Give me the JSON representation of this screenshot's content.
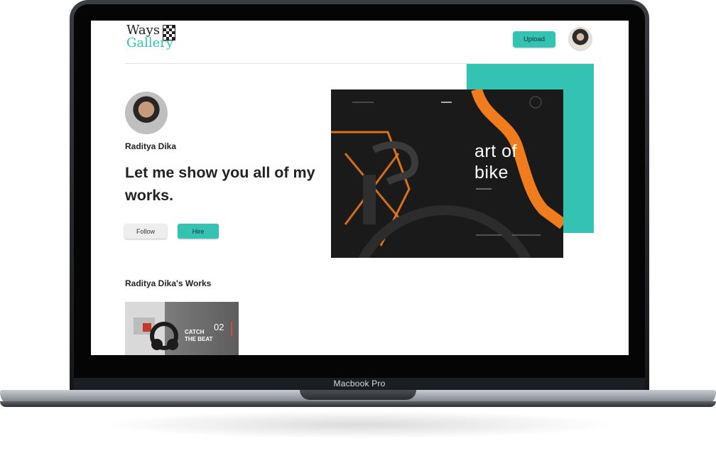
{
  "device_label": "Macbook Pro",
  "header": {
    "logo_top": "Ways",
    "logo_bottom": "Gallery",
    "upload_label": "Upload"
  },
  "profile": {
    "name": "Raditya Dika",
    "headline": "Let me show you all of my works.",
    "follow_label": "Follow",
    "hire_label": "Hire"
  },
  "featured": {
    "title_line1": "art of",
    "title_line2": "bike"
  },
  "works": {
    "section_title": "Raditya Dika's Works",
    "items": [
      {
        "text": "CATCH THE BEAT",
        "number": "02"
      }
    ]
  },
  "colors": {
    "accent": "#34c3b3",
    "orange": "#f07c1e",
    "dark": "#1a1a1a"
  }
}
